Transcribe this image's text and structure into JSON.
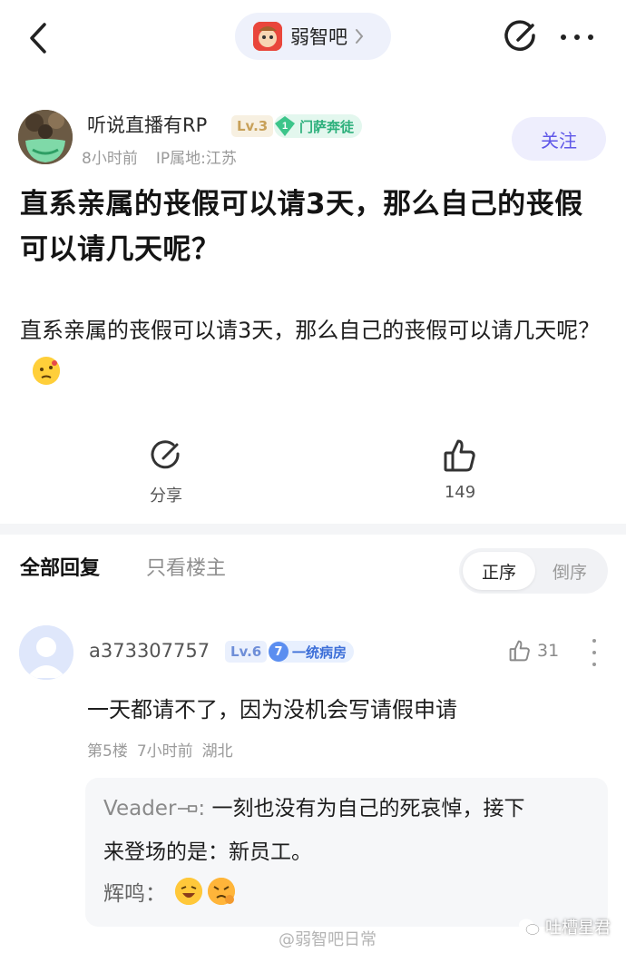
{
  "header": {
    "forum_name": "弱智吧"
  },
  "post": {
    "author": {
      "name": "听说直播有RP",
      "level": "Lv.3",
      "member_rank": "1",
      "member_title": "门萨奔徒",
      "time": "8小时前",
      "ip_location": "IP属地:江苏"
    },
    "follow_label": "关注",
    "title": "直系亲属的丧假可以请3天，那么自己的丧假可以请几天呢？",
    "body": "直系亲属的丧假可以请3天，那么自己的丧假可以请几天呢？",
    "share_label": "分享",
    "like_count": "149"
  },
  "replies_header": {
    "tab_all": "全部回复",
    "tab_op": "只看楼主",
    "sort_asc": "正序",
    "sort_desc": "倒序"
  },
  "reply": {
    "user": "a373307757",
    "level": "Lv.6",
    "group_rank": "7",
    "group_title": "一统病房",
    "like_count": "31",
    "text": "一天都请不了，因为没机会写请假申请",
    "floor": "第5楼",
    "time": "7小时前",
    "location": "湖北",
    "sub_reply": {
      "user": "Veader",
      "text_line1": "一刻也没有为自己的死哀悼，接下",
      "text_line2": "来登场的是：新员工。",
      "user2": "辉鸣："
    }
  },
  "watermarks": {
    "center": "@弱智吧日常",
    "right": "吐槽星君"
  },
  "colors": {
    "accent": "#5f57e8",
    "member_green": "#2db07c",
    "level_blue": "#6e8ed8",
    "emoji_yellow": "#ffc83a"
  }
}
